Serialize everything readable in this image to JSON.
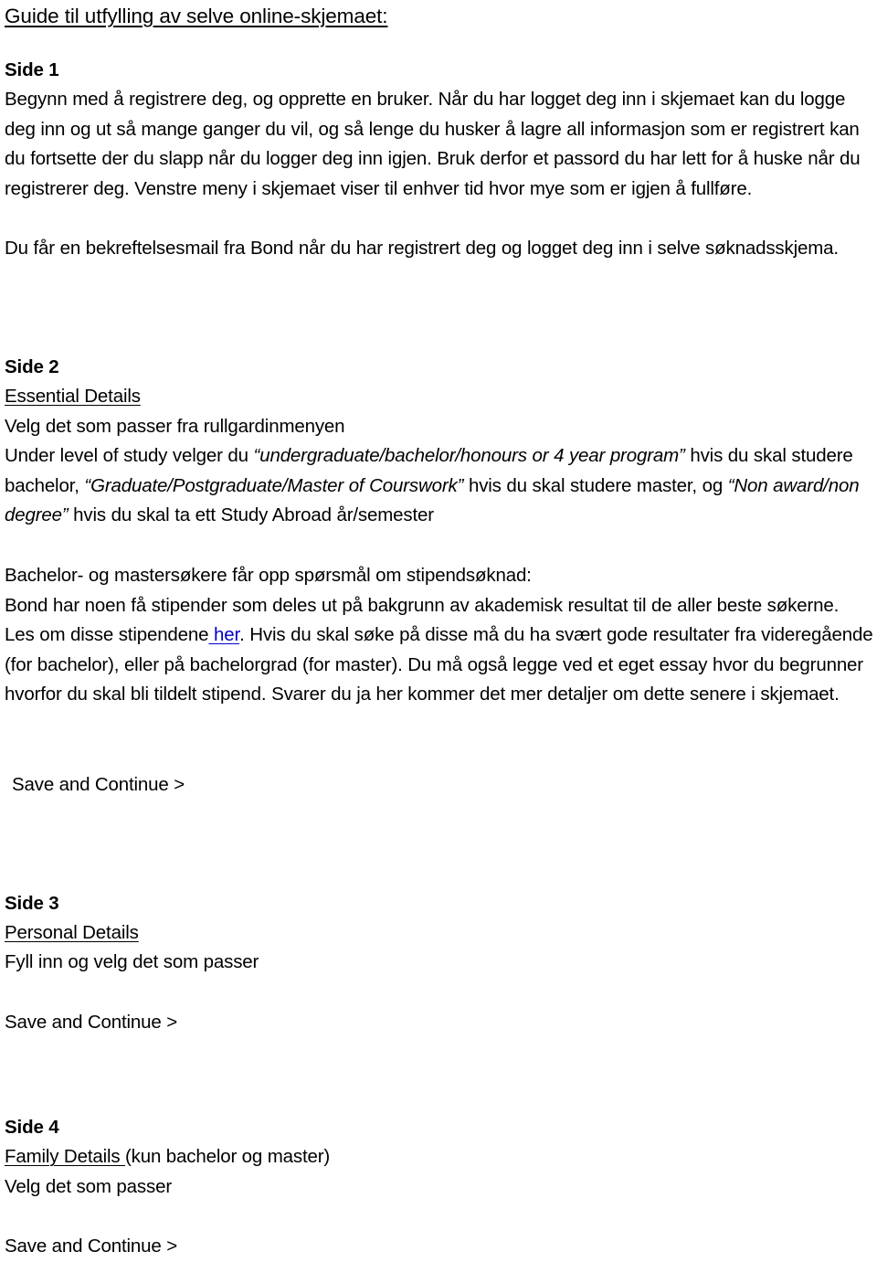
{
  "document": {
    "title": "Guide til utfylling av selve online-skjemaet:",
    "sections": [
      {
        "heading": "Side 1",
        "body_1": "Begynn med å registrere deg, og opprette en bruker. Når du har logget deg inn i skjemaet kan du logge deg inn og ut så mange ganger du vil, og så lenge du husker å lagre all informasjon som er registrert kan du fortsette der du slapp når du logger deg inn igjen. Bruk derfor et passord du har lett for å huske når du registrerer deg. Venstre meny i skjemaet viser til enhver tid hvor mye som er igjen å fullføre.",
        "body_2": "Du får en bekreftelsesmail fra Bond når du har registrert deg og logget deg inn i selve søknadsskjema."
      },
      {
        "heading": "Side 2",
        "subheading": "Essential Details",
        "instruction": "Velg det som passer fra rullgardinmenyen",
        "level_of_study": {
          "lead": "Under level of study velger du ",
          "option_1": "“undergraduate/bachelor/honours or 4 year program”",
          "mid_1": " hvis du skal studere bachelor, ",
          "option_2": "“Graduate/Postgraduate/Master of Courswork”",
          "mid_2": " hvis du skal studere master, og ",
          "option_3": "“Non award/non degree”",
          "tail": " hvis du skal ta ett Study Abroad år/semester"
        },
        "scholarship_heading": "Bachelor- og mastersøkere får opp spørsmål om stipendsøknad:",
        "scholarship_body": {
          "part_1": "Bond har noen få stipender som deles ut på bakgrunn av akademisk resultat til de aller beste søkerne. Les om disse stipendene",
          "link_text": " her",
          "part_2": ". Hvis du skal søke på disse må du ha svært gode resultater fra videregående (for bachelor), eller på bachelorgrad (for master). Du må også legge ved et eget essay hvor du begrunner hvorfor du skal bli tildelt stipend. Svarer du ja her kommer det mer detaljer om dette senere i skjemaet."
        },
        "save_button": "Save and Continue >"
      },
      {
        "heading": "Side 3",
        "subheading": "Personal Details",
        "instruction": "Fyll inn og velg det som passer",
        "save_button": "Save and Continue >"
      },
      {
        "heading": "Side 4",
        "subheading": "Family Details ",
        "subheading_note": "(kun bachelor og master)",
        "instruction": "Velg det som passer",
        "save_button": "Save and Continue >"
      }
    ]
  },
  "colors": {
    "text": "#000000",
    "link": "#0000c8",
    "background": "#ffffff"
  }
}
